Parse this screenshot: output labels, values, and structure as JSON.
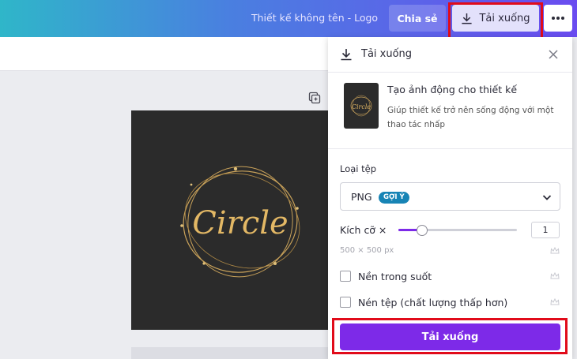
{
  "topbar": {
    "doc_title": "Thiết kế không tên - Logo",
    "share_label": "Chia sẻ",
    "download_label": "Tải xuống",
    "more_icon": "more-dots-icon"
  },
  "canvas": {
    "logo_text": "Circle",
    "background": "#2b2b2b",
    "accent": "#c9a25a"
  },
  "panel": {
    "header_title": "Tải xuống",
    "promo": {
      "title": "Tạo ảnh động cho thiết kế",
      "description": "Giúp thiết kế trở nên sống động với một thao tác nhấp"
    },
    "file_type": {
      "label": "Loại tệp",
      "value": "PNG",
      "badge": "GỢI Ý"
    },
    "size": {
      "label": "Kích cỡ ×",
      "value": "1",
      "slider_fraction": 0.2,
      "dimensions": "500 × 500 px"
    },
    "options": [
      {
        "label": "Nền trong suốt",
        "checked": false
      },
      {
        "label": "Nén tệp (chất lượng thấp hơn)",
        "checked": false
      }
    ],
    "download_button": "Tải xuống"
  },
  "colors": {
    "brand_purple": "#7d2ae8",
    "badge_blue": "#1784b5",
    "highlight_red": "#e10b1a"
  }
}
